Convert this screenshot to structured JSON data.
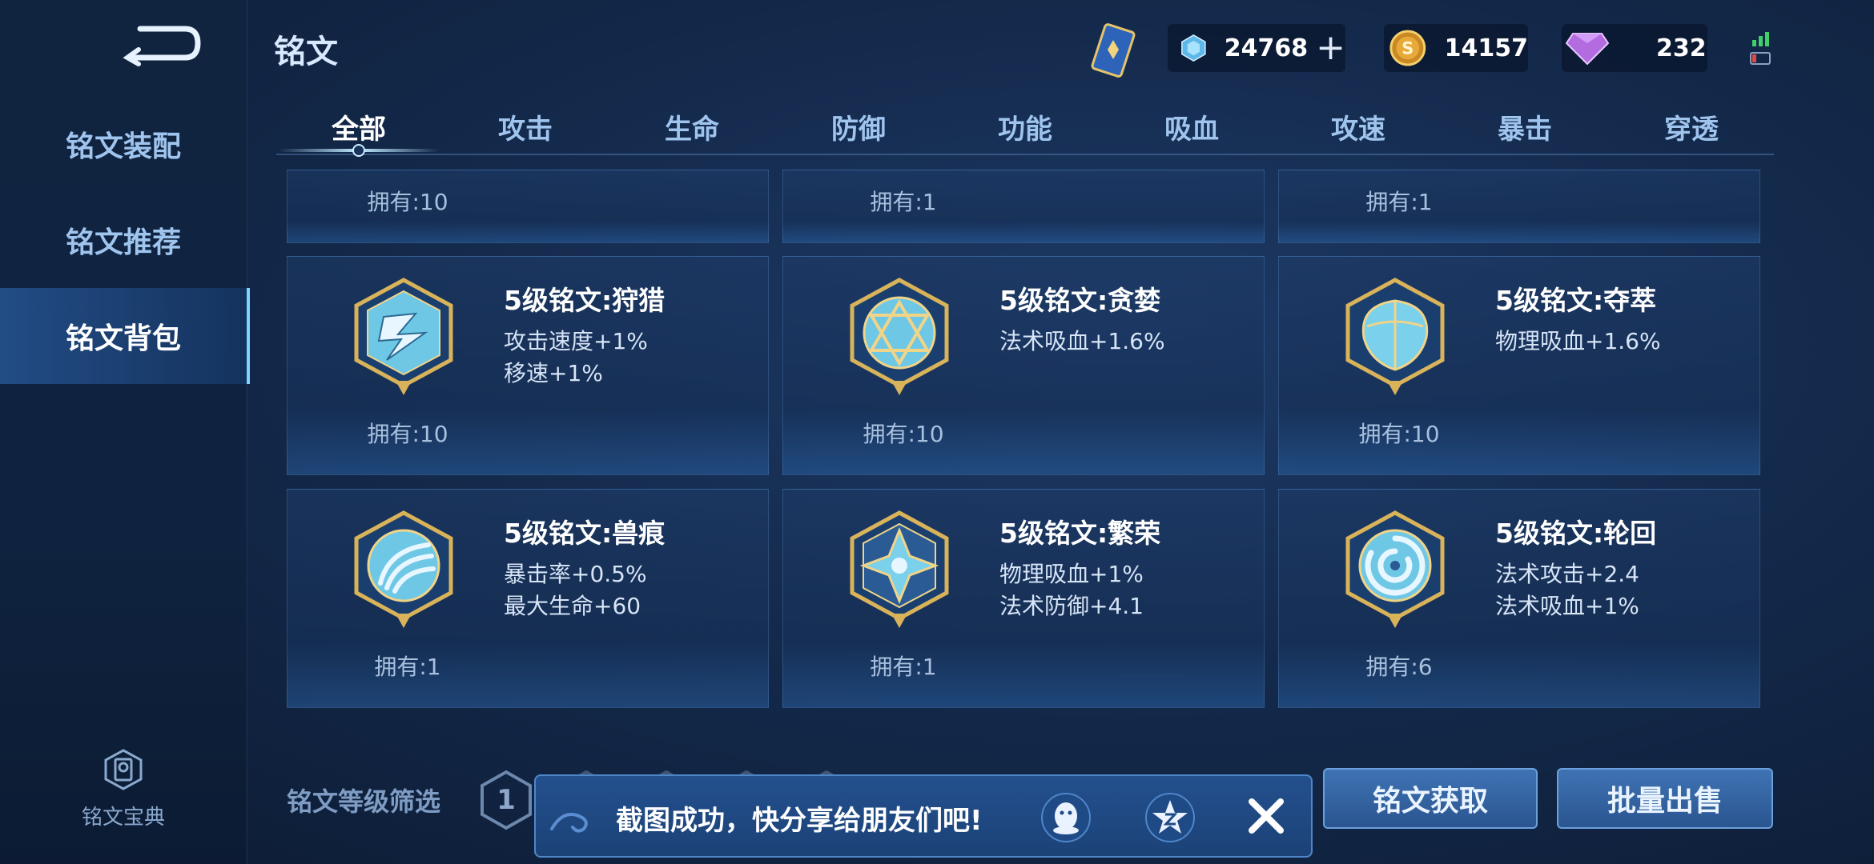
{
  "header": {
    "title": "铭文",
    "resources": [
      {
        "name": "crystal",
        "value": "24768"
      },
      {
        "name": "coin",
        "value": "14157"
      },
      {
        "name": "gem",
        "value": "232"
      }
    ]
  },
  "sidebar": {
    "items": [
      {
        "label": "铭文装配"
      },
      {
        "label": "铭文推荐"
      },
      {
        "label": "铭文背包"
      }
    ],
    "codex_label": "铭文宝典"
  },
  "tabs": [
    {
      "label": "全部"
    },
    {
      "label": "攻击"
    },
    {
      "label": "生命"
    },
    {
      "label": "防御"
    },
    {
      "label": "功能"
    },
    {
      "label": "吸血"
    },
    {
      "label": "攻速"
    },
    {
      "label": "暴击"
    },
    {
      "label": "穿透"
    }
  ],
  "top_row": [
    {
      "owned": "拥有:10"
    },
    {
      "owned": "拥有:1"
    },
    {
      "owned": "拥有:1"
    }
  ],
  "runes": [
    {
      "name": "5级铭文:狩猎",
      "attrs": [
        "攻击速度+1%",
        "移速+1%"
      ],
      "owned": "拥有:10",
      "icon": "hunt-rune-icon"
    },
    {
      "name": "5级铭文:贪婪",
      "attrs": [
        "法术吸血+1.6%"
      ],
      "owned": "拥有:10",
      "icon": "greed-rune-icon"
    },
    {
      "name": "5级铭文:夺萃",
      "attrs": [
        "物理吸血+1.6%"
      ],
      "owned": "拥有:10",
      "icon": "plunder-rune-icon"
    },
    {
      "name": "5级铭文:兽痕",
      "attrs": [
        "暴击率+0.5%",
        "最大生命+60"
      ],
      "owned": "拥有:1",
      "icon": "beast-mark-rune-icon"
    },
    {
      "name": "5级铭文:繁荣",
      "attrs": [
        "物理吸血+1%",
        "法术防御+4.1"
      ],
      "owned": "拥有:1",
      "icon": "prosperity-rune-icon"
    },
    {
      "name": "5级铭文:轮回",
      "attrs": [
        "法术攻击+2.4",
        "法术吸血+1%"
      ],
      "owned": "拥有:6",
      "icon": "samsara-rune-icon"
    }
  ],
  "bottom": {
    "filter_label": "铭文等级筛选",
    "level_first": "1",
    "acquire_label": "铭文获取",
    "bulk_sell_label": "批量出售"
  },
  "toast": {
    "message": "截图成功，快分享给朋友们吧!"
  }
}
